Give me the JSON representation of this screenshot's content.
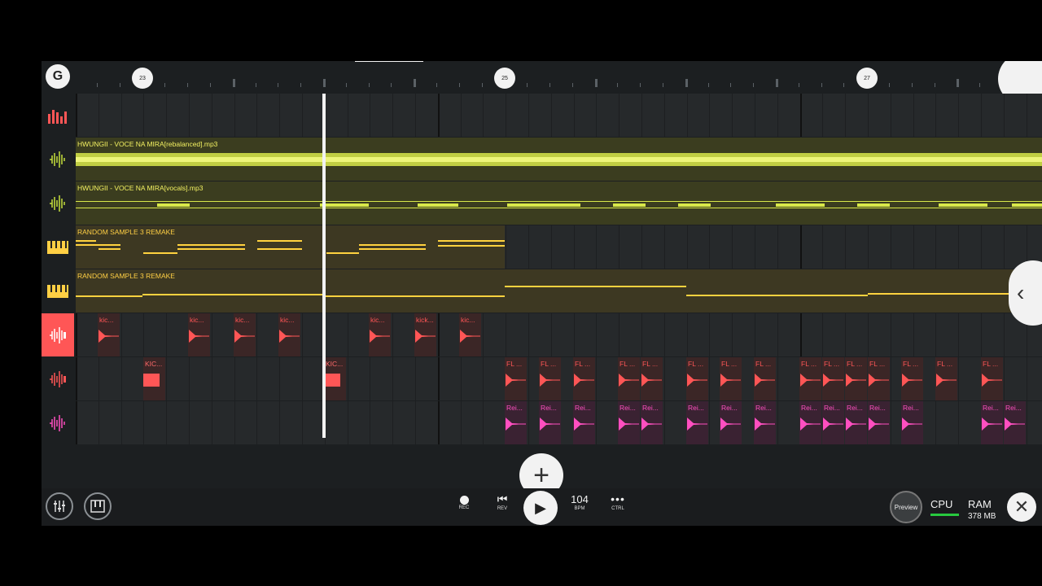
{
  "ruler": {
    "bar_labels": [
      "23",
      "25",
      "27"
    ]
  },
  "tracks": [
    {
      "name": "track-mixer",
      "clips": []
    },
    {
      "name": "track-audio-rebalanced",
      "clips": [
        {
          "label": "HWUNGII - VOCE NA MIRA[rebalanced].mp3"
        }
      ]
    },
    {
      "name": "track-audio-vocals",
      "clips": [
        {
          "label": "HWUNGII - VOCE NA MIRA[vocals].mp3"
        }
      ]
    },
    {
      "name": "track-pattern-1",
      "clips": [
        {
          "label": "RANDOM SAMPLE 3 REMAKE"
        }
      ]
    },
    {
      "name": "track-pattern-2",
      "clips": [
        {
          "label": "RANDOM SAMPLE 3 REMAKE"
        }
      ]
    },
    {
      "name": "track-kick-1",
      "clips": [
        {
          "label": "kic..."
        },
        {
          "label": "kic..."
        },
        {
          "label": "kic..."
        },
        {
          "label": "kic..."
        },
        {
          "label": "kic..."
        },
        {
          "label": "kick..."
        },
        {
          "label": "kic..."
        }
      ]
    },
    {
      "name": "track-kick-2",
      "clips": [
        {
          "label": "KIC..."
        },
        {
          "label": "KIC..."
        },
        {
          "label": "FL ..."
        },
        {
          "label": "FL ..."
        },
        {
          "label": "FL ..."
        },
        {
          "label": "FL ..."
        },
        {
          "label": "FL ..."
        },
        {
          "label": "FL ..."
        },
        {
          "label": "FL ..."
        },
        {
          "label": "FL ..."
        },
        {
          "label": "FL ..."
        },
        {
          "label": "FL ..."
        },
        {
          "label": "FL ..."
        },
        {
          "label": "FL ..."
        },
        {
          "label": "FL ..."
        },
        {
          "label": "FL ..."
        },
        {
          "label": "FL ..."
        }
      ]
    },
    {
      "name": "track-rei",
      "clips": [
        {
          "label": "Rei..."
        },
        {
          "label": "Rei..."
        },
        {
          "label": "Rei..."
        },
        {
          "label": "Rei..."
        },
        {
          "label": "Rei..."
        },
        {
          "label": "Rei..."
        },
        {
          "label": "Rei..."
        },
        {
          "label": "Rei..."
        },
        {
          "label": "Rei..."
        },
        {
          "label": "Rei..."
        },
        {
          "label": "Rei..."
        },
        {
          "label": "Rei..."
        },
        {
          "label": "Rei..."
        },
        {
          "label": "Rei..."
        },
        {
          "label": "Rei..."
        }
      ]
    }
  ],
  "transport": {
    "rec_label": "REC",
    "rev_label": "REV",
    "bpm_value": "104",
    "bpm_label": "BPM",
    "ctrl_label": "CTRL",
    "preview_label": "Preview",
    "cpu_label": "CPU",
    "ram_label": "RAM",
    "ram_value": "378 MB"
  },
  "colors": {
    "audio_clip": "#d9e84a",
    "pattern_clip": "#ffcf44",
    "kick_clip": "#ff5656",
    "rei_clip": "#ff4fc0",
    "cpu_meter": "#27c93f"
  },
  "icons": [
    "fl-logo-icon",
    "mixer-icon",
    "piano-icon",
    "record-icon",
    "rewind-icon",
    "play-icon",
    "more-icon",
    "add-icon",
    "close-icon",
    "collapse-arrow-icon",
    "waveform-icon"
  ]
}
